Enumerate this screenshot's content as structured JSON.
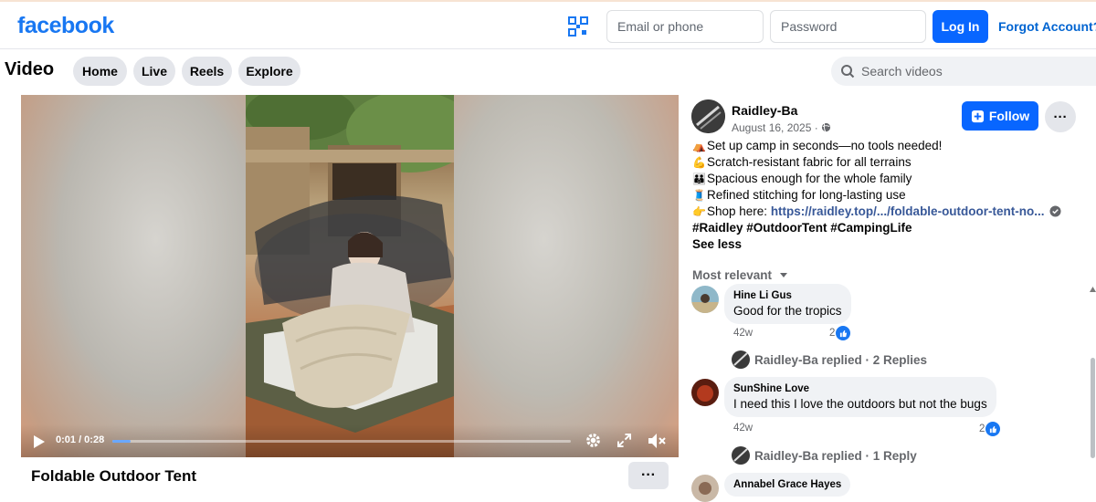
{
  "header": {
    "logo": "facebook",
    "email_placeholder": "Email or phone",
    "password_placeholder": "Password",
    "login_label": "Log In",
    "forgot_label": "Forgot Account?"
  },
  "subnav": {
    "title": "Video",
    "tabs": [
      {
        "label": "Home"
      },
      {
        "label": "Live"
      },
      {
        "label": "Reels"
      },
      {
        "label": "Explore"
      }
    ],
    "search_placeholder": "Search videos"
  },
  "player": {
    "time": "0:01 / 0:28",
    "progress": 0.04
  },
  "post": {
    "title": "Foldable Outdoor Tent",
    "author": "Raidley-Ba",
    "date": "August 16, 2025 · ",
    "follow_label": "Follow",
    "lines": [
      "Set up camp in seconds—no tools needed!",
      "Scratch-resistant fabric for all terrains",
      "Spacious enough for the whole family",
      "Refined stitching for long-lasting use"
    ],
    "shop_prefix": "Shop here: ",
    "shop_link": "https://raidley.top/.../foldable-outdoor-tent-no...",
    "hashtags": "#Raidley #OutdoorTent #CampingLife",
    "see_less": "See less"
  },
  "comments": {
    "sort_label": "Most relevant",
    "items": [
      {
        "name": "Hine Li Gus",
        "text": "Good for the tropics",
        "age": "42w",
        "likes": "2",
        "replies": "Raidley-Ba replied · 2 Replies"
      },
      {
        "name": "SunShine Love",
        "text": "I need this I love the outdoors but not the bugs",
        "age": "42w",
        "likes": "2",
        "replies": "Raidley-Ba replied · 1 Reply"
      },
      {
        "name": "Annabel Grace Hayes",
        "text": "",
        "age": "",
        "likes": "",
        "replies": ""
      }
    ]
  },
  "colors": {
    "brand": "#1877f2",
    "button": "#0866ff"
  }
}
